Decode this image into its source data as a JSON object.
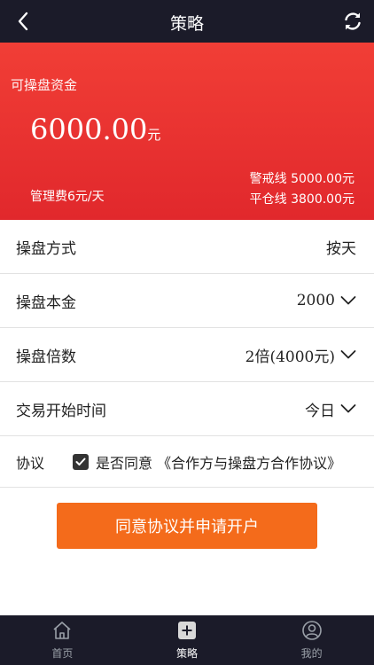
{
  "header": {
    "title": "策略"
  },
  "hero": {
    "label": "可操盘资金",
    "amount": "6000.00",
    "unit": "元",
    "fee": "管理费6元/天",
    "warning_line": "警戒线 5000.00元",
    "close_line": "平仓线 3800.00元"
  },
  "rows": [
    {
      "label": "操盘方式",
      "value": "按天"
    },
    {
      "label": "操盘本金",
      "value": "2000"
    },
    {
      "label": "操盘倍数",
      "value": "2倍(4000元)"
    },
    {
      "label": "交易开始时间",
      "value": "今日"
    }
  ],
  "agreement": {
    "label": "协议",
    "text": "是否同意 《合作方与操盘方合作协议》",
    "checked": true
  },
  "cta": {
    "label": "同意协议并申请开户"
  },
  "tabs": [
    {
      "label": "首页",
      "icon": "home-icon"
    },
    {
      "label": "策略",
      "icon": "plus-icon"
    },
    {
      "label": "我的",
      "icon": "user-icon"
    }
  ],
  "colors": {
    "header_bg": "#1b1b29",
    "hero_bg": "#e8322f",
    "cta_bg": "#f46b1b"
  }
}
